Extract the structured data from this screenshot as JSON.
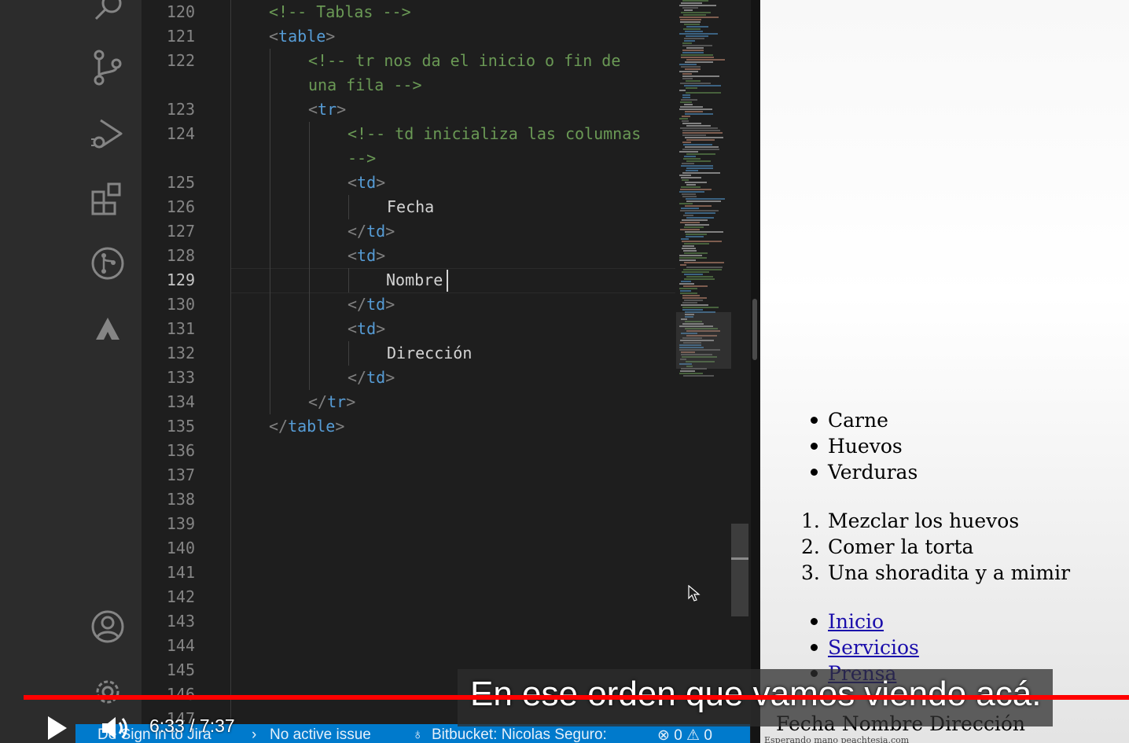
{
  "editor": {
    "line_numbers": [
      "120",
      "121",
      "122",
      "",
      "123",
      "124",
      "",
      "125",
      "126",
      "127",
      "128",
      "129",
      "130",
      "131",
      "132",
      "133",
      "134",
      "135",
      "136",
      "137",
      "138",
      "139",
      "140",
      "141",
      "142",
      "143",
      "144",
      "145",
      "146",
      "147"
    ],
    "active_line": "129",
    "code": {
      "l120": "<!-- Tablas -->",
      "l121_open": "<",
      "l121_tag": "table",
      "l121_close": ">",
      "l122a": "<!-- tr nos da el inicio o fin de",
      "l122b": "una fila -->",
      "l123_tag": "tr",
      "l124a": "<!-- td inicializa las columnas",
      "l124b": "-->",
      "td_tag": "td",
      "cell1": "Fecha",
      "cell2": "Nombre",
      "cell3": "Dirección",
      "lt": "<",
      "lt_slash": "</",
      "gt": ">"
    }
  },
  "preview": {
    "unordered": [
      "Carne",
      "Huevos",
      "Verduras"
    ],
    "ordered_numbers": [
      "1.",
      "2.",
      "3."
    ],
    "ordered": [
      "Mezclar los huevos",
      "Comer la torta",
      "Una shoradita y a mimir"
    ],
    "links": [
      "Inicio",
      "Servicios",
      "Prensa"
    ],
    "table_row": "Fecha Nombre Dirección",
    "footer": "Esperando mano peachtesia.com"
  },
  "status_bar": {
    "sign_in": "De Sign in to Jira",
    "no_issue": "No active issue",
    "bitbucket": "Bitbucket: Nicolas Seguro:",
    "problems": "⊗ 0 ⚠ 0"
  },
  "video": {
    "caption": "En ese orden que vamos viendo acá.",
    "time": "6:33 / 7:37",
    "progress": 0.89,
    "progress_color": "#ff0000"
  },
  "colors": {
    "comment": "#6a9955",
    "tag": "#569cd6",
    "text": "#d4d4d4",
    "status_bar": "#007acc"
  },
  "icons": [
    "search-icon",
    "source-control-icon",
    "run-debug-icon",
    "extensions-icon",
    "git-graph-icon",
    "atlassian-icon",
    "account-icon",
    "settings-gear-icon",
    "play-icon",
    "volume-icon",
    "mouse-pointer-icon"
  ]
}
